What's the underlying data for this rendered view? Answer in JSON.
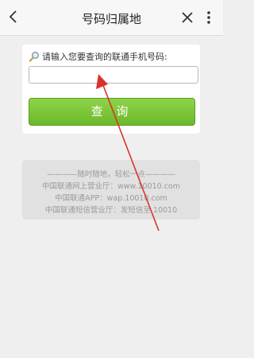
{
  "header": {
    "title": "号码归属地",
    "back_icon": "chevron-left-icon",
    "close_icon": "close-icon",
    "more_icon": "more-vertical-icon"
  },
  "form": {
    "prompt": "请输入您要查询的联通手机号码:",
    "prompt_icon": "magnifier-icon",
    "input_value": "",
    "button_label": "查 询",
    "button_color": "#7cc53a"
  },
  "info": {
    "slogan": "————随时随地，轻松一点————",
    "lines": [
      "中国联通网上营业厅：www.10010.com",
      "中国联通APP：wap.10010.com",
      "中国联通短信营业厅：发短信至 10010"
    ]
  },
  "annotation": {
    "arrow_color": "#d9342b"
  }
}
